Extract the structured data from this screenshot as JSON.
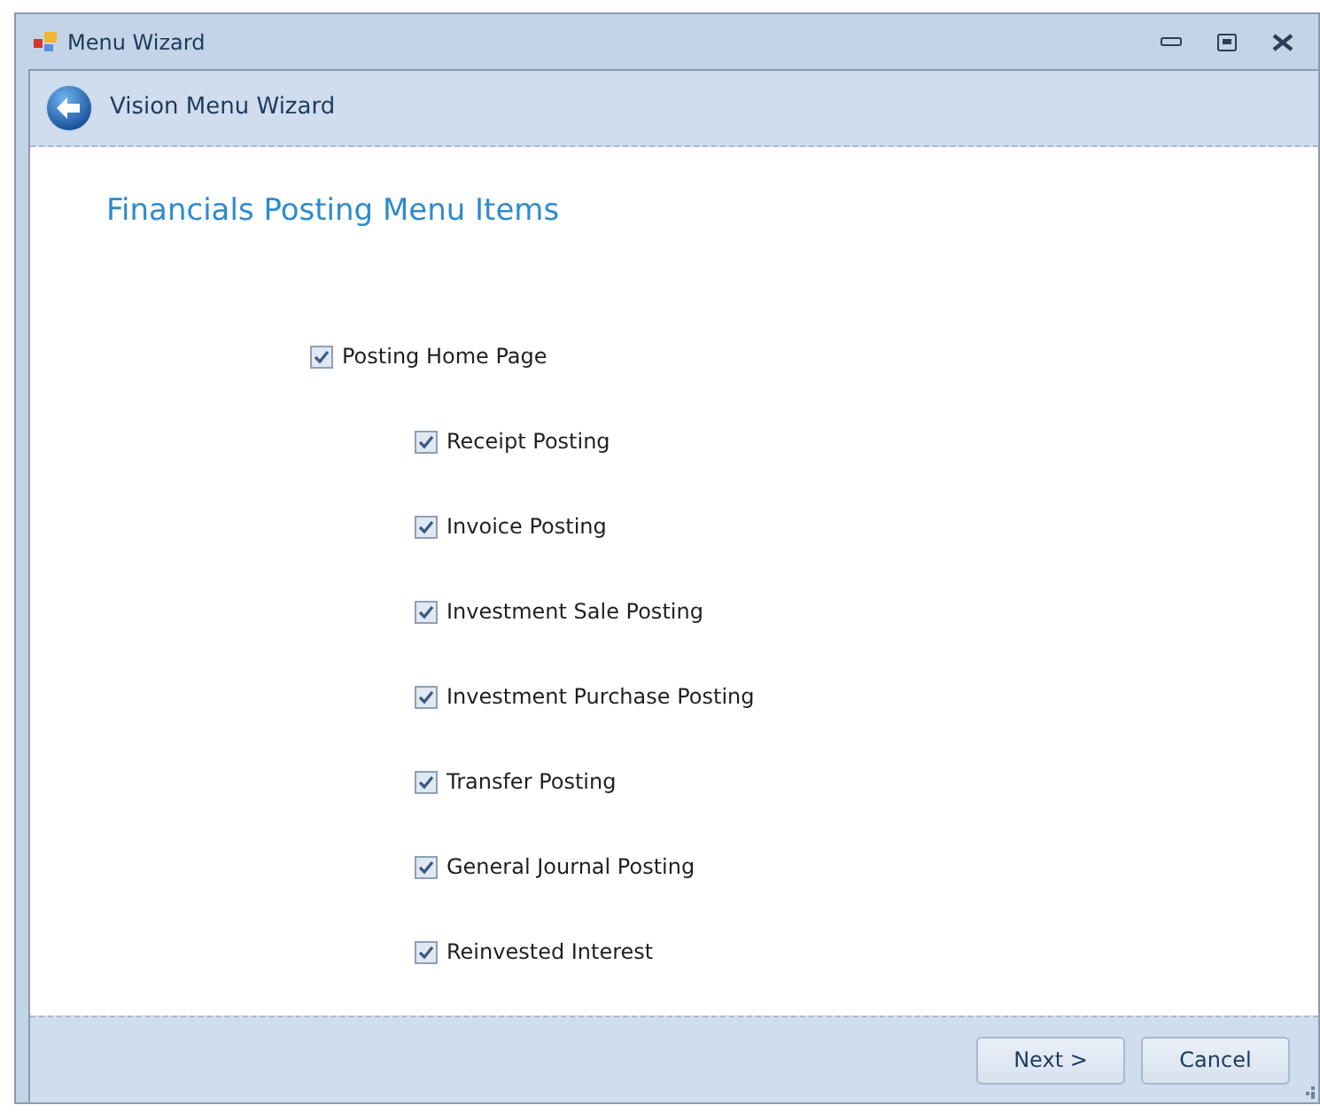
{
  "window": {
    "title": "Menu Wizard"
  },
  "header": {
    "title": "Vision Menu Wizard"
  },
  "page_title": "Financials Posting Menu Items",
  "menu_items": [
    {
      "label": "Posting Home Page",
      "checked": true,
      "children": [
        {
          "label": "Receipt Posting",
          "checked": true
        },
        {
          "label": "Invoice Posting",
          "checked": true
        },
        {
          "label": "Investment Sale Posting",
          "checked": true
        },
        {
          "label": "Investment Purchase Posting",
          "checked": true
        },
        {
          "label": "Transfer Posting",
          "checked": true
        },
        {
          "label": "General Journal Posting",
          "checked": true
        },
        {
          "label": "Reinvested Interest",
          "checked": true
        }
      ]
    }
  ],
  "buttons": [
    {
      "label": "Next >"
    },
    {
      "label": "Cancel"
    }
  ]
}
